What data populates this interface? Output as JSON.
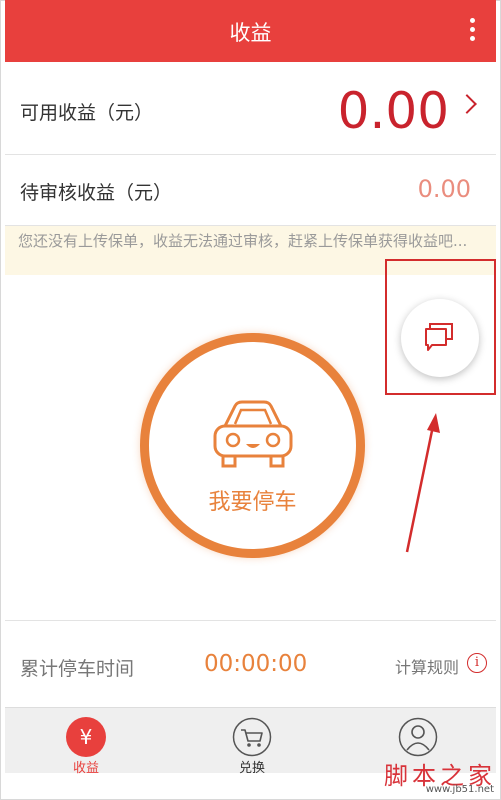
{
  "header": {
    "title": "收益",
    "more_icon": "more-vertical-icon"
  },
  "earnings": {
    "available_label": "可用收益（元）",
    "available_value": "0.00",
    "pending_label": "待审核收益（元）",
    "pending_value": "0.00"
  },
  "notice": "您还没有上传保单，收益无法通过审核，赶紧上传保单获得收益吧...",
  "park": {
    "label": "我要停车",
    "icon": "car-icon"
  },
  "stats": {
    "total_label": "累计停车时间",
    "total_time": "00:00:00",
    "rules_label": "计算规则",
    "rules_icon": "info-icon"
  },
  "tabs": [
    {
      "label": "收益",
      "icon": "yen-icon",
      "active": true
    },
    {
      "label": "兑换",
      "icon": "cart-icon",
      "active": false
    },
    {
      "label": "",
      "icon": "profile-icon",
      "active": false
    }
  ],
  "watermark": {
    "text": "脚本之家",
    "url": "www.jb51.net"
  },
  "colors": {
    "primary": "#e8403d",
    "accent": "#e8823c",
    "value_red": "#c9232d",
    "notice_bg": "#fdf7e4"
  }
}
